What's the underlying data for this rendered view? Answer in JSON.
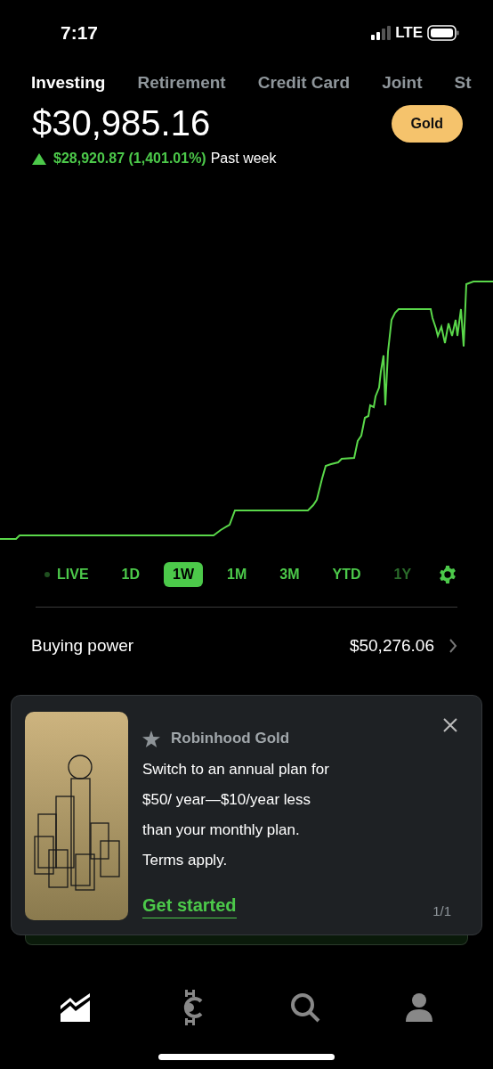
{
  "status_bar": {
    "time": "7:17",
    "network": "LTE"
  },
  "account_tabs": [
    {
      "label": "Investing",
      "selected": true
    },
    {
      "label": "Retirement",
      "selected": false
    },
    {
      "label": "Credit Card",
      "selected": false
    },
    {
      "label": "Joint",
      "selected": false
    },
    {
      "label": "St",
      "selected": false
    }
  ],
  "balance": "$30,985.16",
  "gold_button": "Gold",
  "change": {
    "amount": "$28,920.87 (1,401.01%)",
    "period": "Past week"
  },
  "ranges": [
    {
      "label": "LIVE",
      "selected": false
    },
    {
      "label": "1D",
      "selected": false
    },
    {
      "label": "1W",
      "selected": true
    },
    {
      "label": "1M",
      "selected": false
    },
    {
      "label": "3M",
      "selected": false
    },
    {
      "label": "YTD",
      "selected": false
    },
    {
      "label": "1Y",
      "selected": false
    }
  ],
  "buying_power": {
    "label": "Buying power",
    "value": "$50,276.06"
  },
  "promo": {
    "title": "Robinhood Gold",
    "text": "Switch to an annual plan for $50/ year—$10/year less than your monthly plan. Terms apply.",
    "action": "Get started",
    "pager": "1/1"
  },
  "nav": [
    {
      "selected": true
    },
    {
      "selected": false
    },
    {
      "selected": false
    },
    {
      "selected": false
    }
  ]
}
